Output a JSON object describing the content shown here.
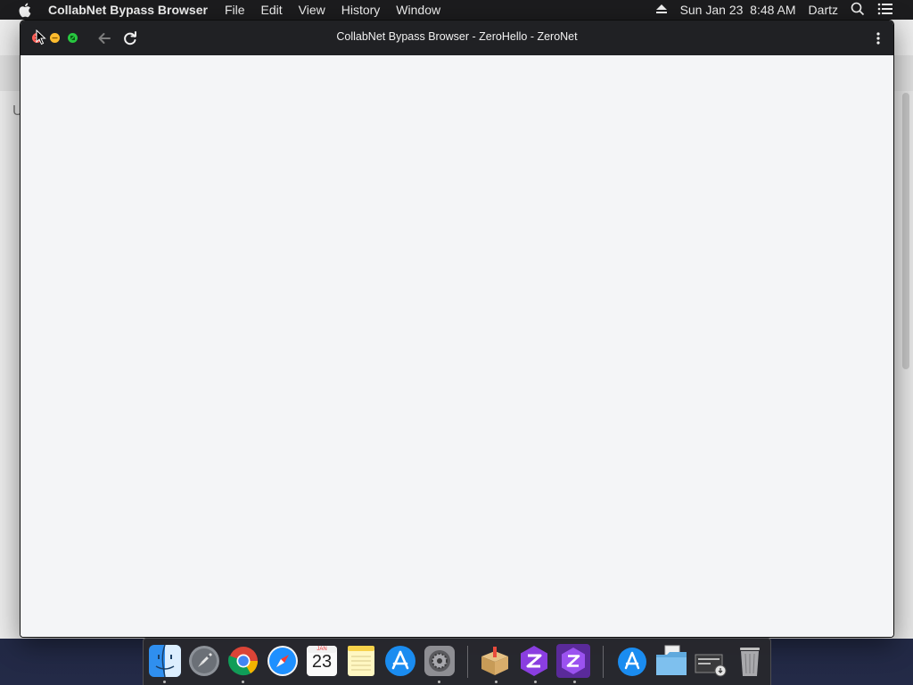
{
  "menubar": {
    "app_name": "CollabNet Bypass Browser",
    "menus": [
      "File",
      "Edit",
      "View",
      "History",
      "Window"
    ],
    "clock": "Sun Jan 23  8:48 AM",
    "user": "Dartz",
    "icons": [
      "apple-icon",
      "eject-icon",
      "spotlight-search-icon",
      "notification-center-icon"
    ]
  },
  "background_window": {
    "partial_text": "U"
  },
  "window": {
    "title": "CollabNet Bypass Browser - ZeroHello - ZeroNet",
    "controls": [
      "close-button",
      "minimize-button",
      "maximize-button"
    ],
    "toolbar_icons": [
      "back-arrow-icon",
      "reload-icon",
      "more-options-icon"
    ]
  },
  "dock": {
    "calendar": {
      "month": "JAN",
      "day": "23"
    },
    "apps": [
      {
        "name": "finder",
        "running": true
      },
      {
        "name": "launchpad",
        "running": false
      },
      {
        "name": "chrome",
        "running": true
      },
      {
        "name": "safari",
        "running": false
      },
      {
        "name": "calendar",
        "running": false
      },
      {
        "name": "notes",
        "running": false
      },
      {
        "name": "app-store",
        "running": false
      },
      {
        "name": "system-preferences",
        "running": true
      },
      {
        "name": "installer",
        "running": true
      },
      {
        "name": "zeronet-1",
        "running": true
      },
      {
        "name": "zeronet-2",
        "running": true
      },
      {
        "name": "app-store-folder",
        "running": false
      },
      {
        "name": "documents-folder",
        "running": false
      },
      {
        "name": "downloads-stack",
        "running": false
      },
      {
        "name": "trash",
        "running": false
      }
    ]
  },
  "colors": {
    "menubar_bg": "#1c1c1e",
    "titlebar_bg": "#202124",
    "content_bg": "#f4f5f7",
    "close": "#ff5f57",
    "minimize": "#febc2e",
    "maximize": "#28c840"
  }
}
